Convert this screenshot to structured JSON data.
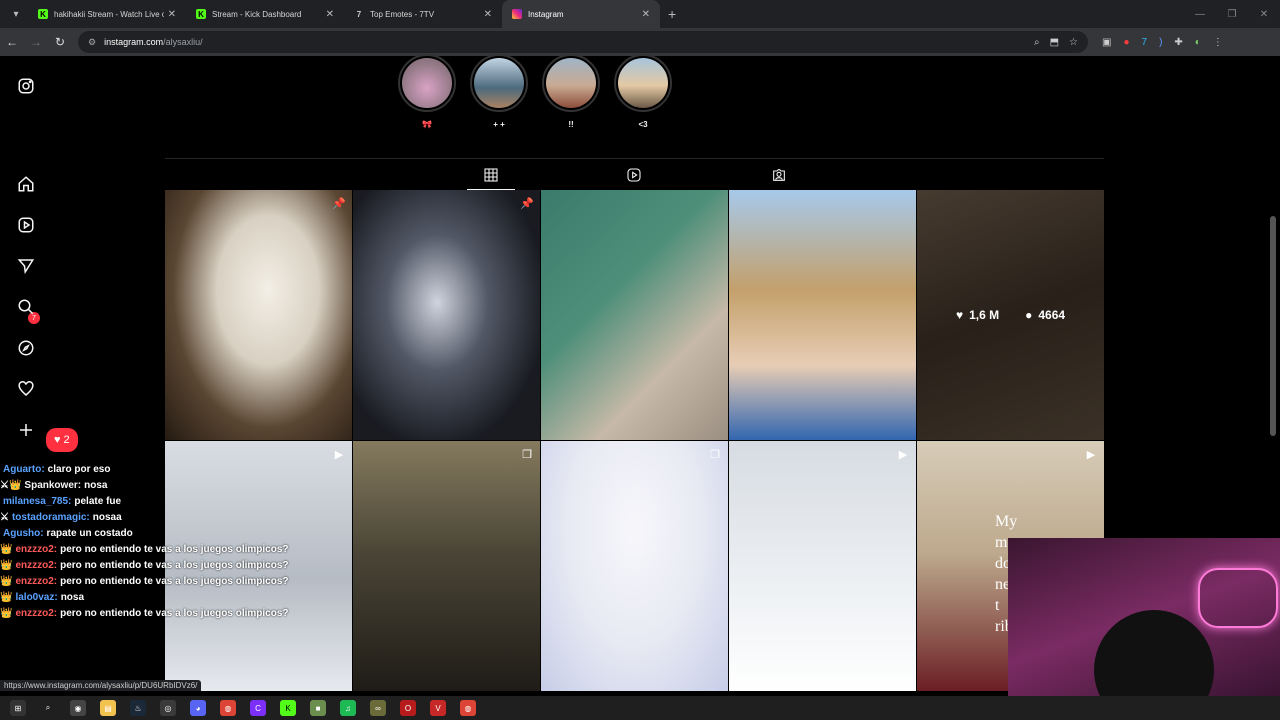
{
  "browser": {
    "tabs": [
      {
        "title": "hakihakii Stream - Watch Live o",
        "favicon": "kick-icon",
        "active": false
      },
      {
        "title": "Stream - Kick Dashboard",
        "favicon": "kick-icon",
        "active": false
      },
      {
        "title": "Top Emotes - 7TV",
        "favicon": "7tv-icon",
        "active": false
      },
      {
        "title": "Instagram",
        "favicon": "instagram-icon",
        "active": true
      }
    ],
    "url_host": "instagram.com",
    "url_path": "/alysaxliu/"
  },
  "instagram": {
    "highlights": [
      {
        "label": "🎀",
        "color": "#b79aa6"
      },
      {
        "label": "+ +",
        "color": "#6f8fa6"
      },
      {
        "label": "!!",
        "color": "#b1826a"
      },
      {
        "label": "<3",
        "color": "#d9b28c"
      }
    ],
    "notification_badge": "7",
    "notification_pill": "2",
    "hover_post": {
      "likes": "1,6 M",
      "comments": "4664"
    },
    "post6_text": "My\nme\ndo\nne\nt\nribl"
  },
  "chat": [
    {
      "user": "Aguarto:",
      "text": "claro por eso",
      "user_color": "#5aa2ff",
      "badges": ""
    },
    {
      "user": "Spankower:",
      "text": "nosa",
      "user_color": "#f5f5f5",
      "badges": "⚔👑"
    },
    {
      "user": "milanesa_785:",
      "text": "pelate fue",
      "user_color": "#5aa2ff",
      "badges": ""
    },
    {
      "user": "tostadoramagic:",
      "text": "nosaa",
      "user_color": "#5aa2ff",
      "badges": "⚔"
    },
    {
      "user": "Agusho:",
      "text": "rapate un costado",
      "user_color": "#5aa2ff",
      "badges": ""
    },
    {
      "user": "enzzzo2:",
      "text": "pero no entiendo te vas a los juegos olimpicos?",
      "user_color": "#ff5a5a",
      "badges": "👑"
    },
    {
      "user": "enzzzo2:",
      "text": "pero no entiendo te vas a los juegos olimpicos?",
      "user_color": "#ff5a5a",
      "badges": "👑"
    },
    {
      "user": "enzzzo2:",
      "text": "pero no entiendo te vas a los juegos olimpicos?",
      "user_color": "#ff5a5a",
      "badges": "👑"
    },
    {
      "user": "lalo0vaz:",
      "text": "nosa",
      "user_color": "#5aa2ff",
      "badges": "👑"
    },
    {
      "user": "enzzzo2:",
      "text": "pero no entiendo te vas a los juegos olimpicos?",
      "user_color": "#ff5a5a",
      "badges": "👑"
    }
  ],
  "status_url": "https://www.instagram.com/alysaxliu/p/DU6URbIDVz6/"
}
